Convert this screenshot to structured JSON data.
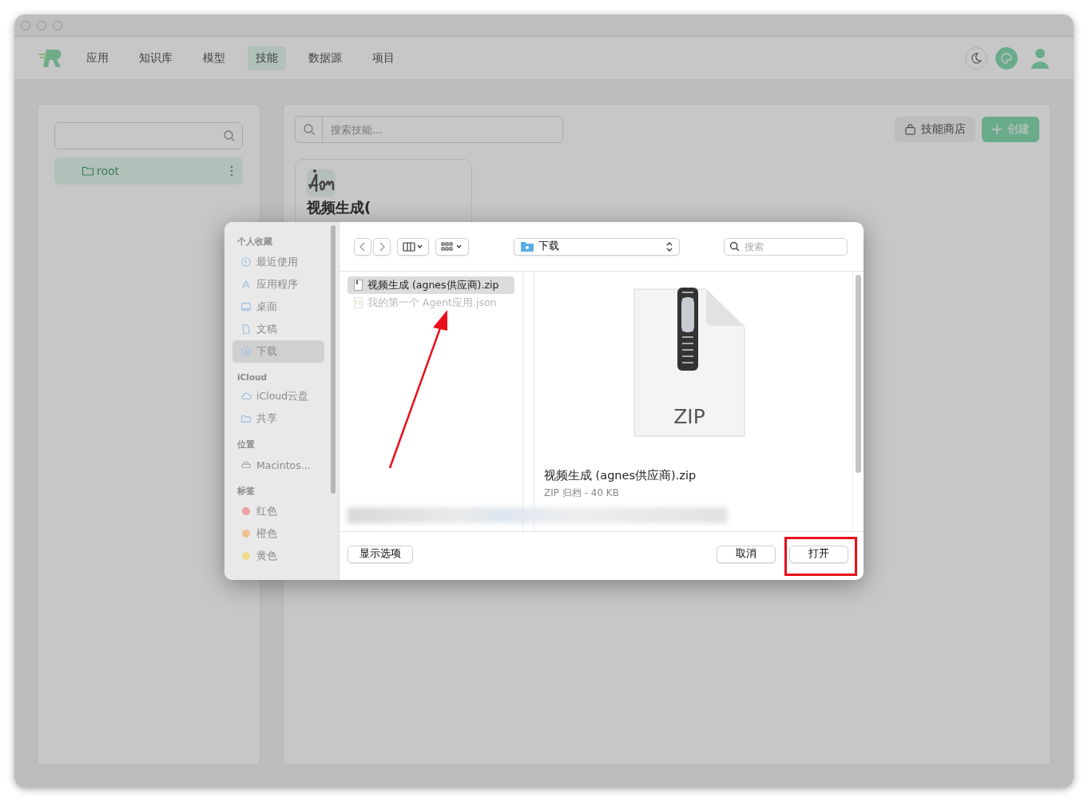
{
  "header": {
    "nav": [
      {
        "label": "应用",
        "selected": false
      },
      {
        "label": "知识库",
        "selected": false
      },
      {
        "label": "模型",
        "selected": false
      },
      {
        "label": "技能",
        "selected": true
      },
      {
        "label": "数据源",
        "selected": false
      },
      {
        "label": "项目",
        "selected": false
      }
    ]
  },
  "sidebar": {
    "folders": [
      {
        "label": "root",
        "selected": true
      }
    ]
  },
  "main": {
    "search": {
      "placeholder": "搜索技能..."
    },
    "actions": [
      {
        "label": "技能商店",
        "kind": "secondary"
      },
      {
        "label": "创建",
        "kind": "primary"
      }
    ],
    "cards": [
      {
        "title": "视频生成("
      }
    ]
  },
  "dialog": {
    "sections": [
      {
        "title": "个人收藏",
        "items": [
          {
            "label": "最近使用",
            "selected": false
          },
          {
            "label": "应用程序",
            "selected": false
          },
          {
            "label": "桌面",
            "selected": false
          },
          {
            "label": "文稿",
            "selected": false
          },
          {
            "label": "下载",
            "selected": true
          }
        ]
      },
      {
        "title": "iCloud",
        "items": [
          {
            "label": "iCloud云盘",
            "selected": false
          },
          {
            "label": "共享",
            "selected": false
          }
        ]
      },
      {
        "title": "位置",
        "items": [
          {
            "label": "Macintos...",
            "selected": false
          }
        ]
      },
      {
        "title": "标签",
        "items": [
          {
            "label": "红色",
            "selected": false,
            "color": "#f0a0a0"
          },
          {
            "label": "橙色",
            "selected": false,
            "color": "#f0c090"
          },
          {
            "label": "黄色",
            "selected": false,
            "color": "#f0dc8c"
          }
        ]
      }
    ],
    "location": "下载",
    "search": {
      "placeholder": "搜索"
    },
    "files": [
      {
        "name": "视频生成 (agnes供应商).zip",
        "selected": true,
        "disabled": false
      },
      {
        "name": "我的第一个 Agent应用.json",
        "selected": false,
        "disabled": true
      }
    ],
    "preview": {
      "icon_label": "ZIP",
      "name": "视频生成 (agnes供应商).zip",
      "info": "ZIP 归档 - 40 KB"
    },
    "buttons": [
      {
        "label": "显示选项",
        "highlighted": false
      },
      {
        "label": "取消",
        "highlighted": false
      },
      {
        "label": "打开",
        "highlighted": true
      }
    ]
  }
}
